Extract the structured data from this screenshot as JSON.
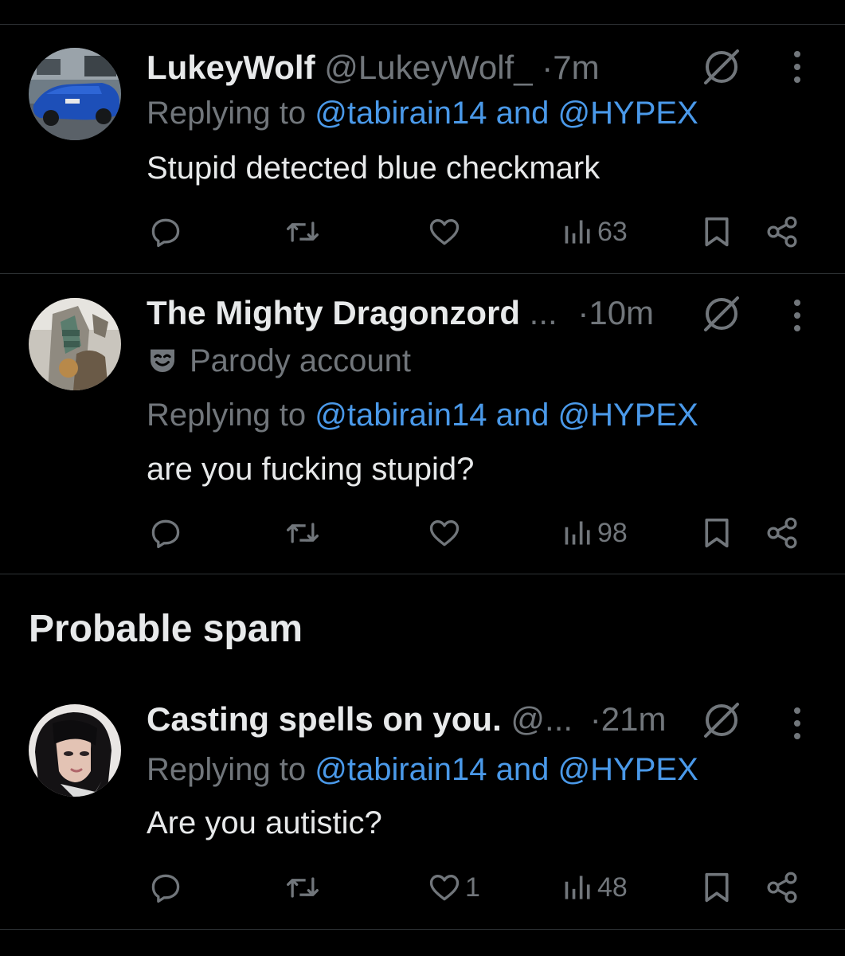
{
  "tweets": [
    {
      "name": "LukeyWolf",
      "handle": "@LukeyWolf_",
      "dot": "·",
      "time": "7m",
      "reply_prefix": "Replying to",
      "reply_mention_1": "@tabirain14",
      "reply_and": "and",
      "reply_mention_2": "@HYPEX",
      "text": "Stupid detected blue checkmark",
      "likes": "",
      "views": "63"
    },
    {
      "name": "The Mighty Dragonzord",
      "name_ellipsis": "...",
      "dot": "·",
      "time": "10m",
      "label": "Parody account",
      "reply_prefix": "Replying to",
      "reply_mention_1": "@tabirain14",
      "reply_and": "and",
      "reply_mention_2": "@HYPEX",
      "text": "are you fucking stupid?",
      "likes": "",
      "views": "98"
    },
    {
      "name": "Casting spells on you.",
      "handle": "@...",
      "dot": "·",
      "time": "21m",
      "reply_prefix": "Replying to",
      "reply_mention_1": "@tabirain14",
      "reply_and": "and",
      "reply_mention_2": "@HYPEX",
      "text": "Are you autistic?",
      "likes": "1",
      "views": "48"
    }
  ],
  "section_title": "Probable spam",
  "icons": {
    "reply": "reply-icon",
    "retweet": "retweet-icon",
    "like": "heart-icon",
    "views": "views-icon",
    "bookmark": "bookmark-icon",
    "share": "share-icon",
    "grok": "slashed-circle-icon",
    "more": "more-icon",
    "parody": "mask-icon"
  },
  "colors": {
    "background": "#000000",
    "text": "#e7e9ea",
    "muted": "#71767b",
    "link": "#4a99e9",
    "divider": "#2f3336"
  }
}
